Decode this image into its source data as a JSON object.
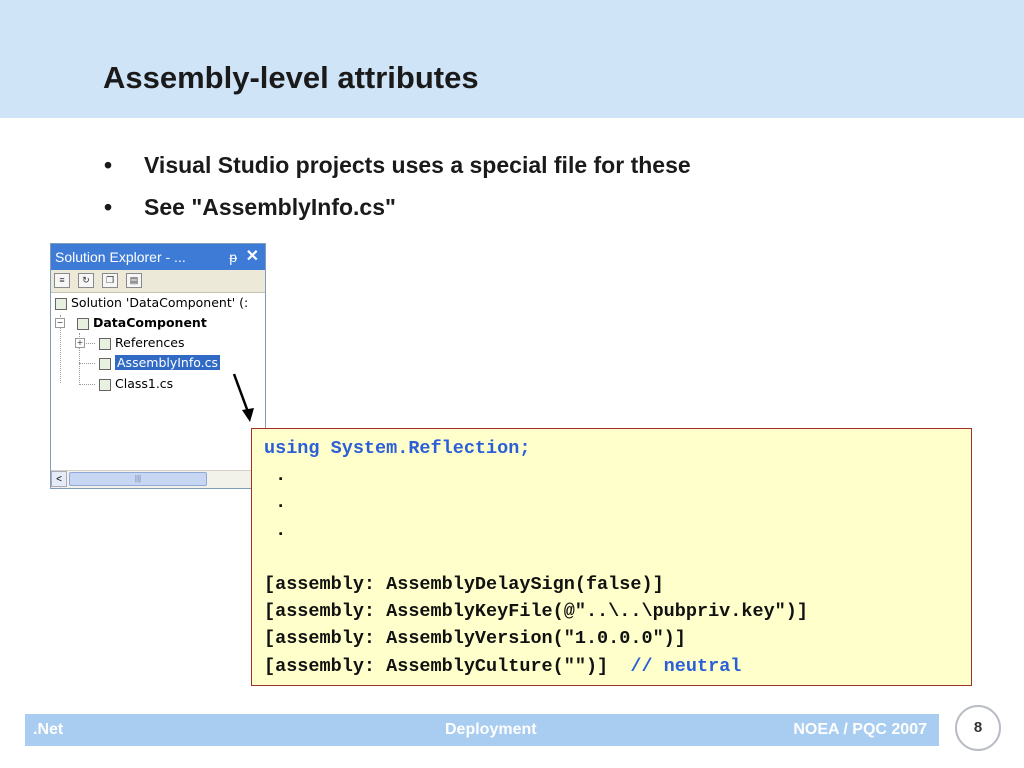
{
  "slide": {
    "title": "Assembly-level attributes",
    "bullets": [
      "Visual Studio projects uses a special file for these",
      "See \"AssemblyInfo.cs\""
    ],
    "bullet_symbol": "•"
  },
  "solution_explorer": {
    "title": "Solution Explorer - ...",
    "pin_icon": "pin-icon",
    "close_icon": "close-icon",
    "tree": {
      "solution": "Solution 'DataComponent' (:",
      "project": "DataComponent",
      "references": "References",
      "file_assemblyinfo": "AssemblyInfo.cs",
      "file_class1": "Class1.cs"
    },
    "scroll_left": "<",
    "scroll_thumb": "|||"
  },
  "code": {
    "line1": "using System.Reflection;",
    "dot1": " .",
    "dot2": " .",
    "dot3": " .",
    "line5": "[assembly: AssemblyDelaySign(false)]",
    "line6": "[assembly: AssemblyKeyFile(@\"..\\..\\pubpriv.key\")]",
    "line7": "[assembly: AssemblyVersion(\"1.0.0.0\")]",
    "line8_code": "[assembly: AssemblyCulture(\"\")]  ",
    "line8_comment": "// neutral"
  },
  "footer": {
    "left": ".Net",
    "middle": "Deployment",
    "right": "NOEA / PQC 2007",
    "page_number": "8"
  },
  "colors": {
    "header_bg": "#cfe4f7",
    "code_bg": "#ffffcc",
    "code_border": "#a0302a",
    "keyword_blue": "#2a5fd8",
    "footer_bg": "#a8cdf0",
    "selection": "#316ac5"
  }
}
